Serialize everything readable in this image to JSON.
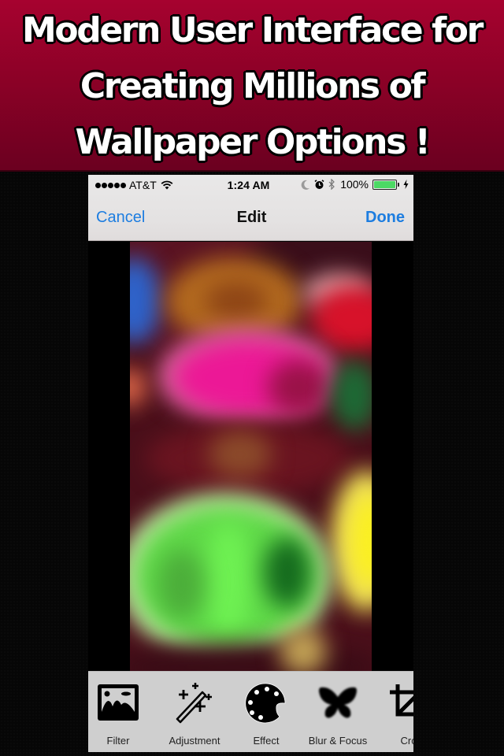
{
  "banner": {
    "lines": [
      "Modern User Interface for",
      "Creating Millions of",
      "Wallpaper Options !"
    ],
    "colors": {
      "top": "#a6022f",
      "bottom": "#6b0020",
      "text": "#ffffff",
      "outline": "#000000"
    }
  },
  "status_bar": {
    "signal_bars": 5,
    "carrier": "AT&T",
    "wifi_icon": "wifi-icon",
    "time": "1:24 AM",
    "icons": [
      "moon-icon",
      "alarm-icon",
      "bluetooth-icon"
    ],
    "battery_percent_label": "100%",
    "battery_level": 1.0,
    "charging_icon": "charging-bolt-icon"
  },
  "nav_bar": {
    "cancel_label": "Cancel",
    "title": "Edit",
    "done_label": "Done",
    "accent_color": "#1d7de0"
  },
  "photo": {
    "description": "blurred colored powder bowls",
    "icon": "photo-preview"
  },
  "toolbar": {
    "tools": [
      {
        "label": "Filter",
        "icon": "image-landscape-icon"
      },
      {
        "label": "Adjustment",
        "icon": "magic-wand-icon"
      },
      {
        "label": "Effect",
        "icon": "palette-icon"
      },
      {
        "label": "Blur & Focus",
        "icon": "butterfly-icon"
      },
      {
        "label": "Cro",
        "icon": "crop-icon"
      }
    ]
  }
}
